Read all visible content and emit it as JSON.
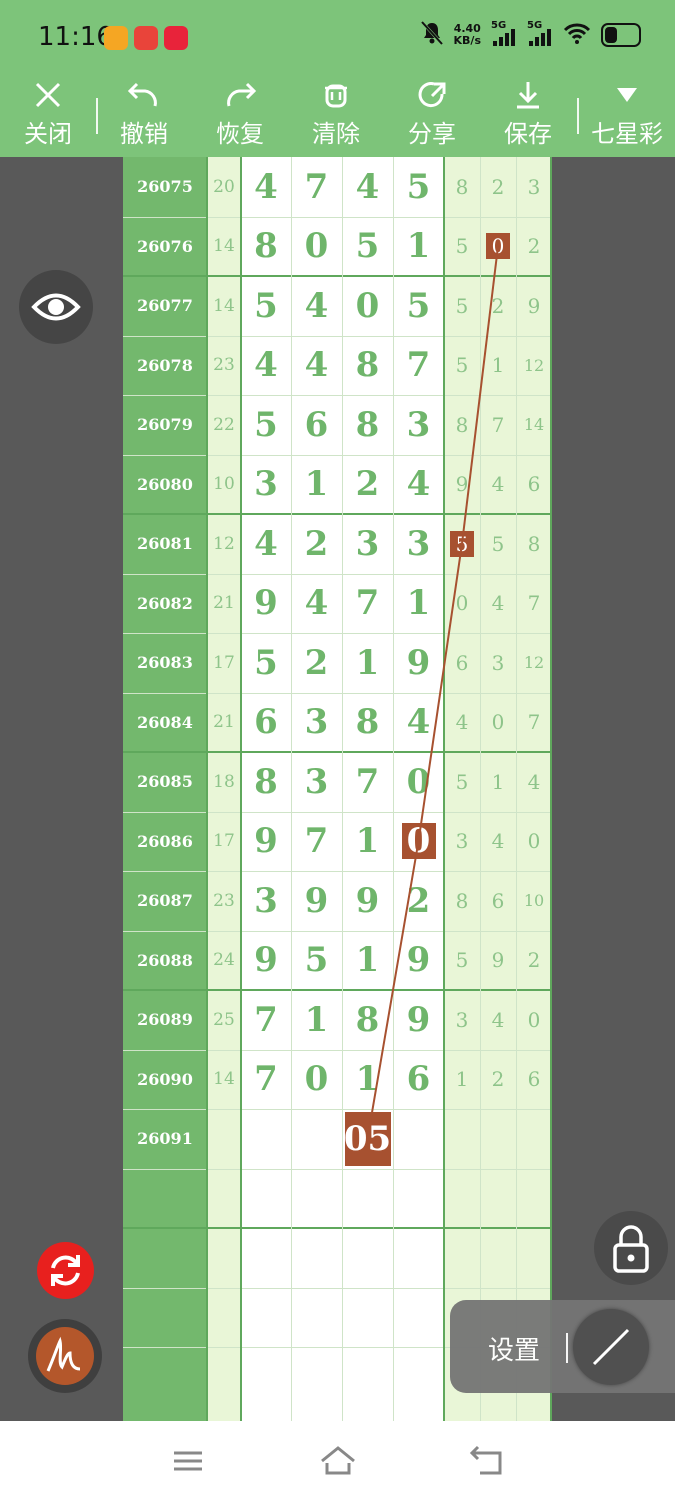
{
  "status_bar": {
    "time": "11:16",
    "speed": "4.40",
    "speed_unit": "KB/s",
    "net1": "5G",
    "net2": "5G",
    "battery_level": 0.35
  },
  "toolbar": {
    "close": "关闭",
    "undo": "撤销",
    "redo": "恢复",
    "clear": "清除",
    "share": "分享",
    "save": "保存",
    "lottery": "七星彩"
  },
  "rows": [
    {
      "issue": "26075",
      "sum": "20",
      "digits": [
        "4",
        "7",
        "4",
        "5"
      ],
      "tails": [
        "8",
        "2",
        "3"
      ]
    },
    {
      "issue": "26076",
      "sum": "14",
      "digits": [
        "8",
        "0",
        "5",
        "1"
      ],
      "tails": [
        "5",
        "0",
        "2"
      ]
    },
    {
      "issue": "26077",
      "sum": "14",
      "digits": [
        "5",
        "4",
        "0",
        "5"
      ],
      "tails": [
        "5",
        "2",
        "9"
      ]
    },
    {
      "issue": "26078",
      "sum": "23",
      "digits": [
        "4",
        "4",
        "8",
        "7"
      ],
      "tails": [
        "5",
        "1",
        "12"
      ]
    },
    {
      "issue": "26079",
      "sum": "22",
      "digits": [
        "5",
        "6",
        "8",
        "3"
      ],
      "tails": [
        "8",
        "7",
        "14"
      ]
    },
    {
      "issue": "26080",
      "sum": "10",
      "digits": [
        "3",
        "1",
        "2",
        "4"
      ],
      "tails": [
        "9",
        "4",
        "6"
      ]
    },
    {
      "issue": "26081",
      "sum": "12",
      "digits": [
        "4",
        "2",
        "3",
        "3"
      ],
      "tails": [
        "5",
        "5",
        "8"
      ]
    },
    {
      "issue": "26082",
      "sum": "21",
      "digits": [
        "9",
        "4",
        "7",
        "1"
      ],
      "tails": [
        "0",
        "4",
        "7"
      ]
    },
    {
      "issue": "26083",
      "sum": "17",
      "digits": [
        "5",
        "2",
        "1",
        "9"
      ],
      "tails": [
        "6",
        "3",
        "12"
      ]
    },
    {
      "issue": "26084",
      "sum": "21",
      "digits": [
        "6",
        "3",
        "8",
        "4"
      ],
      "tails": [
        "4",
        "0",
        "7"
      ]
    },
    {
      "issue": "26085",
      "sum": "18",
      "digits": [
        "8",
        "3",
        "7",
        "0"
      ],
      "tails": [
        "5",
        "1",
        "4"
      ]
    },
    {
      "issue": "26086",
      "sum": "17",
      "digits": [
        "9",
        "7",
        "1",
        "0"
      ],
      "tails": [
        "3",
        "4",
        "0"
      ]
    },
    {
      "issue": "26087",
      "sum": "23",
      "digits": [
        "3",
        "9",
        "9",
        "2"
      ],
      "tails": [
        "8",
        "6",
        "10"
      ]
    },
    {
      "issue": "26088",
      "sum": "24",
      "digits": [
        "9",
        "5",
        "1",
        "9"
      ],
      "tails": [
        "5",
        "9",
        "2"
      ]
    },
    {
      "issue": "26089",
      "sum": "25",
      "digits": [
        "7",
        "1",
        "8",
        "9"
      ],
      "tails": [
        "3",
        "4",
        "0"
      ]
    },
    {
      "issue": "26090",
      "sum": "14",
      "digits": [
        "7",
        "0",
        "1",
        "6"
      ],
      "tails": [
        "1",
        "2",
        "6"
      ]
    },
    {
      "issue": "26091",
      "sum": "",
      "digits": [
        "",
        "",
        "",
        ""
      ],
      "tails": [
        "",
        "",
        ""
      ]
    }
  ],
  "highlights": [
    {
      "row": 1,
      "kind": "tail",
      "col": 1
    },
    {
      "row": 6,
      "kind": "tail",
      "col": 0
    },
    {
      "row": 11,
      "kind": "digit",
      "col": 3
    }
  ],
  "prediction": {
    "row": 16,
    "col": 2,
    "text": "05"
  },
  "buttons": {
    "settings": "设置"
  },
  "colors": {
    "header_green": "#7dc47a",
    "issue_green": "#73b86d",
    "digit_green": "#6fb56b",
    "highlight": "#a75130",
    "refresh_red": "#e8201e"
  }
}
